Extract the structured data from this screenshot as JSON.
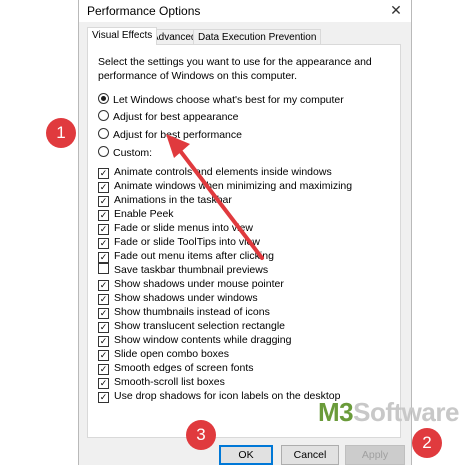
{
  "window": {
    "title": "Performance Options",
    "close": "✕"
  },
  "tabs": [
    {
      "label": "Visual Effects"
    },
    {
      "label": "Advanced"
    },
    {
      "label": "Data Execution Prevention"
    }
  ],
  "description": "Select the settings you want to use for the appearance and performance of Windows on this computer.",
  "radios": [
    {
      "label": "Let Windows choose what's best for my computer",
      "checked": true
    },
    {
      "label": "Adjust for best appearance",
      "checked": false
    },
    {
      "label": "Adjust for best performance",
      "checked": false
    },
    {
      "label": "Custom:",
      "checked": false
    }
  ],
  "effects": [
    {
      "label": "Animate controls and elements inside windows",
      "checked": true
    },
    {
      "label": "Animate windows when minimizing and maximizing",
      "checked": true
    },
    {
      "label": "Animations in the taskbar",
      "checked": true
    },
    {
      "label": "Enable Peek",
      "checked": true
    },
    {
      "label": "Fade or slide menus into view",
      "checked": true
    },
    {
      "label": "Fade or slide ToolTips into view",
      "checked": true
    },
    {
      "label": "Fade out menu items after clicking",
      "checked": true
    },
    {
      "label": "Save taskbar thumbnail previews",
      "checked": false
    },
    {
      "label": "Show shadows under mouse pointer",
      "checked": true
    },
    {
      "label": "Show shadows under windows",
      "checked": true
    },
    {
      "label": "Show thumbnails instead of icons",
      "checked": true
    },
    {
      "label": "Show translucent selection rectangle",
      "checked": true
    },
    {
      "label": "Show window contents while dragging",
      "checked": true
    },
    {
      "label": "Slide open combo boxes",
      "checked": true
    },
    {
      "label": "Smooth edges of screen fonts",
      "checked": true
    },
    {
      "label": "Smooth-scroll list boxes",
      "checked": true
    },
    {
      "label": "Use drop shadows for icon labels on the desktop",
      "checked": true
    }
  ],
  "buttons": {
    "ok": "OK",
    "cancel": "Cancel",
    "apply": "Apply"
  },
  "markers": {
    "one": "1",
    "two": "2",
    "three": "3"
  },
  "watermark": {
    "brand": "M3",
    "rest": "Software"
  },
  "colors": {
    "marker": "#e03a3e",
    "accent": "#0078d7",
    "watermark_green": "#6a9b3a"
  }
}
